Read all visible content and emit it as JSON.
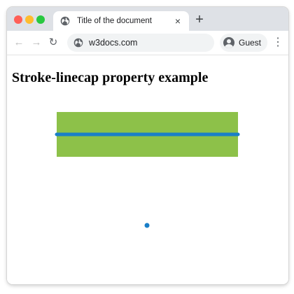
{
  "browser": {
    "tab": {
      "title": "Title of the document",
      "favicon": "globe-icon",
      "close_icon": "×"
    },
    "new_tab_icon": "+",
    "nav": {
      "back_icon": "←",
      "forward_icon": "→",
      "reload_icon": "↻"
    },
    "address_bar": {
      "icon": "globe-icon",
      "url": "w3docs.com"
    },
    "profile": {
      "label": "Guest",
      "icon": "avatar-icon"
    },
    "menu_icon": "⋮"
  },
  "page": {
    "heading": "Stroke-linecap property example"
  },
  "demo": {
    "rect_color": "#8dc149",
    "line_color": "#1a7fc8",
    "dot_color": "#1a7fc8",
    "linecap": "round"
  }
}
